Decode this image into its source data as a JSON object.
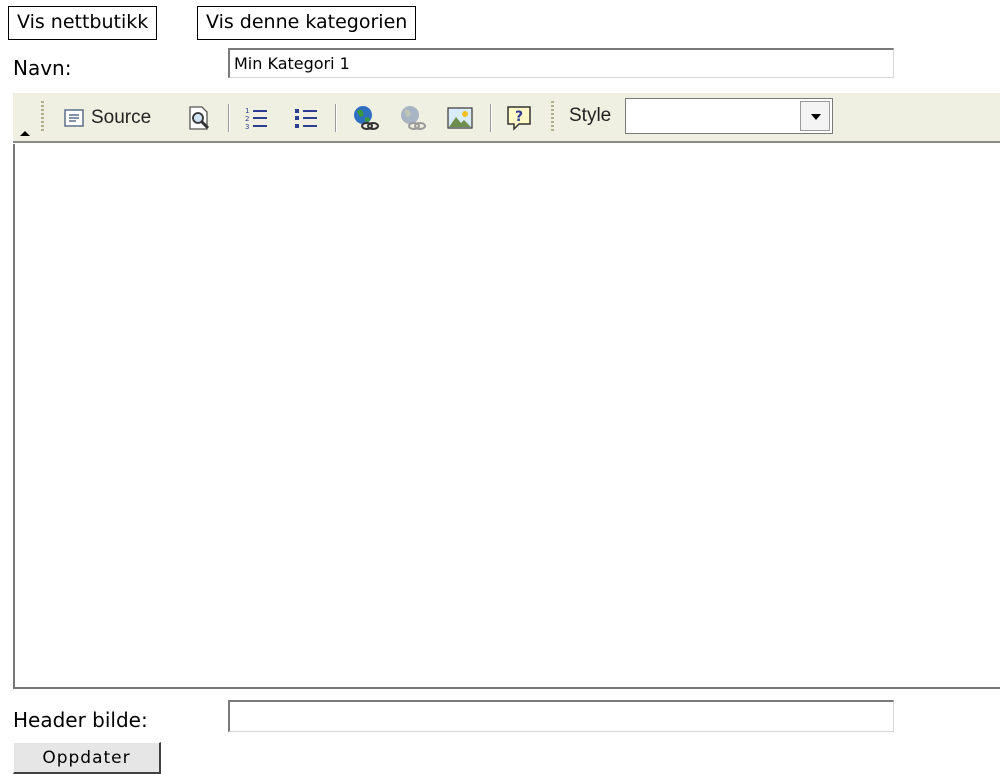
{
  "links": {
    "show_store": "Vis nettbutikk",
    "show_category": "Vis denne kategorien"
  },
  "form": {
    "name_label": "Navn:",
    "name_value": "Min Kategori 1",
    "header_image_label": "Header bilde:",
    "header_image_value": "",
    "submit_label": "Oppdater"
  },
  "toolbar": {
    "source_label": "Source",
    "style_label": "Style",
    "style_value": "",
    "icons": [
      "collapse-icon",
      "source-icon",
      "preview-icon",
      "numbered-list-icon",
      "bulleted-list-icon",
      "insert-link-icon",
      "remove-link-icon",
      "insert-image-icon",
      "help-icon",
      "style-dropdown-arrow-icon"
    ]
  },
  "editor": {
    "content": ""
  },
  "colors": {
    "toolbar_bg": "#f0f0e2",
    "border": "#7a7a7a"
  }
}
